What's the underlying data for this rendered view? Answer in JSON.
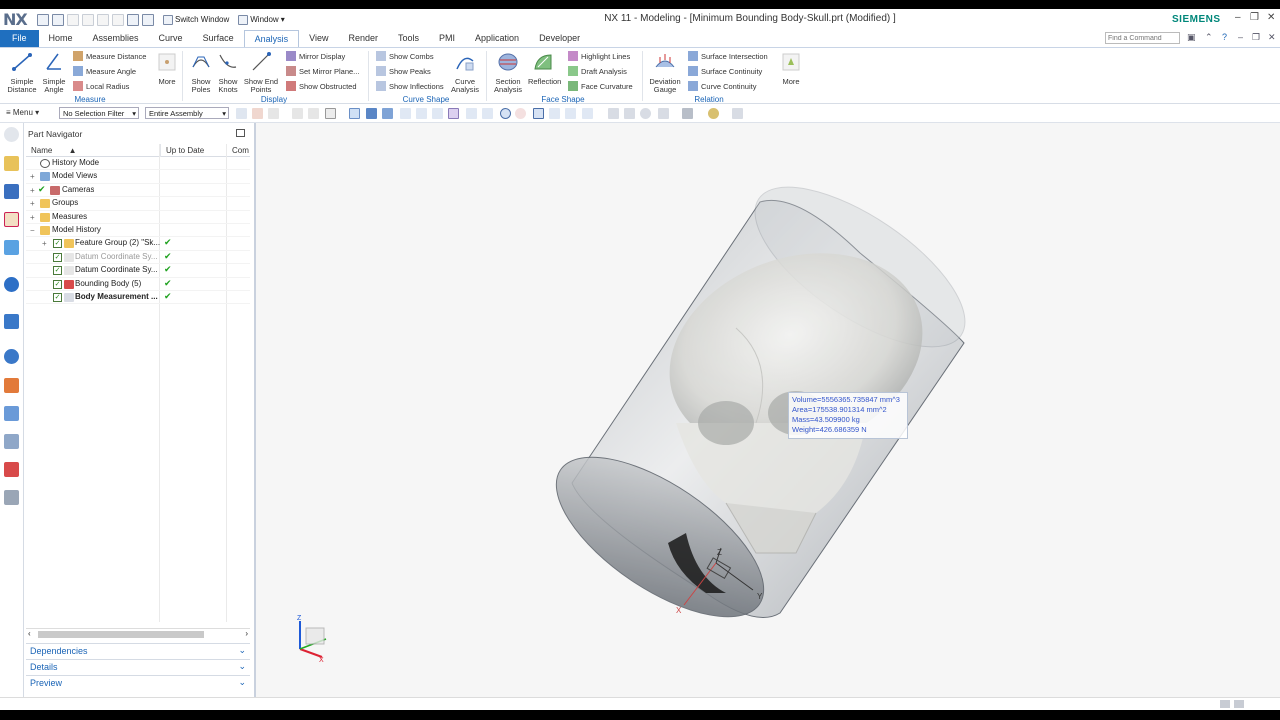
{
  "app": {
    "logo": "NX",
    "title": "NX 11 - Modeling - [Minimum Bounding Body-Skull.prt (Modified) ]",
    "brand": "SIEMENS",
    "switch_window": "Switch Window",
    "window_menu": "Window",
    "find_placeholder": "Find a Command"
  },
  "menu_tabs": [
    "File",
    "Home",
    "Assemblies",
    "Curve",
    "Surface",
    "Analysis",
    "View",
    "Render",
    "Tools",
    "PMI",
    "Application",
    "Developer"
  ],
  "active_tab": "Analysis",
  "ribbon": {
    "measure": {
      "label": "Measure",
      "simple_distance": "Simple Distance",
      "simple_angle": "Simple Angle",
      "measure_distance": "Measure Distance",
      "measure_angle": "Measure Angle",
      "local_radius": "Local Radius",
      "more": "More"
    },
    "display": {
      "label": "Display",
      "show_poles": "Show Poles",
      "show_knots": "Show Knots",
      "show_end_points": "Show End Points",
      "mirror_display": "Mirror Display",
      "set_mirror_plane": "Set Mirror Plane...",
      "show_obstructed": "Show Obstructed"
    },
    "curve_shape": {
      "label": "Curve Shape",
      "show_combs": "Show Combs",
      "show_peaks": "Show Peaks",
      "show_inflections": "Show Inflections",
      "curve_analysis": "Curve Analysis"
    },
    "face_shape": {
      "label": "Face Shape",
      "section_analysis": "Section Analysis",
      "reflection": "Reflection",
      "highlight_lines": "Highlight Lines",
      "draft_analysis": "Draft Analysis",
      "face_curvature": "Face Curvature"
    },
    "relation": {
      "label": "Relation",
      "deviation_gauge": "Deviation Gauge",
      "surface_intersection": "Surface Intersection",
      "surface_continuity": "Surface Continuity",
      "curve_continuity": "Curve Continuity",
      "more": "More"
    }
  },
  "toolbar": {
    "menu": "Menu",
    "selection_filter": "No Selection Filter",
    "assembly_scope": "Entire Assembly"
  },
  "navigator": {
    "title": "Part Navigator",
    "columns": [
      "Name",
      "Up to Date",
      "Com"
    ],
    "items": [
      {
        "label": "History Mode",
        "icon": "clock-icon",
        "up_to_date": false
      },
      {
        "label": "Model Views",
        "icon": "views-icon",
        "up_to_date": false
      },
      {
        "label": "Cameras",
        "icon": "camera-icon",
        "up_to_date": false
      },
      {
        "label": "Groups",
        "icon": "folder-icon",
        "up_to_date": false
      },
      {
        "label": "Measures",
        "icon": "folder-icon",
        "up_to_date": false
      },
      {
        "label": "Model History",
        "icon": "folder-icon",
        "up_to_date": false
      },
      {
        "label": "Feature Group (2) \"Sk...",
        "icon": "feature-group-icon",
        "up_to_date": true
      },
      {
        "label": "Datum Coordinate Sy...",
        "icon": "datum-csys-icon",
        "up_to_date": true
      },
      {
        "label": "Datum Coordinate Sy...",
        "icon": "datum-csys-icon",
        "up_to_date": true
      },
      {
        "label": "Bounding Body (5)",
        "icon": "bounding-body-icon",
        "up_to_date": true
      },
      {
        "label": "Body Measurement ...",
        "icon": "body-measurement-icon",
        "up_to_date": true
      }
    ],
    "panels": [
      "Dependencies",
      "Details",
      "Preview"
    ]
  },
  "measurement": {
    "volume": "Volume=5556365.735847 mm^3",
    "area": "Area=175538.901314 mm^2",
    "mass": "Mass=43.509900 kg",
    "weight": "Weight=426.686359 N"
  },
  "axes": {
    "x": "X",
    "y": "Y",
    "z": "Z"
  },
  "colors": {
    "file_tab": "#1f6fbf",
    "accent": "#1a64b6",
    "brand": "#00877a",
    "check": "#1ea11e"
  }
}
